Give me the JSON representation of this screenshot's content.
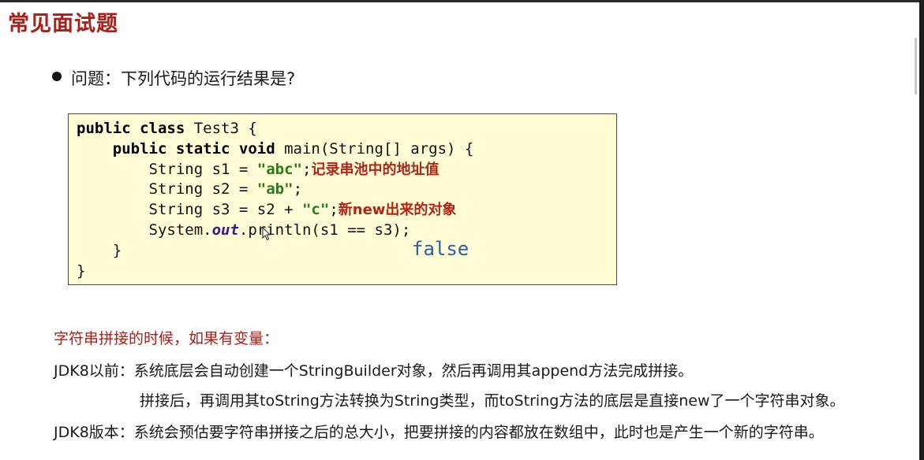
{
  "title": "常见面试题",
  "question": "问题：下列代码的运行结果是?",
  "code": {
    "l1": {
      "a": "public class",
      "b": " Test3 {"
    },
    "l2": {
      "indent": "    ",
      "a": "public static void",
      "b": " main(String[] args) {"
    },
    "l3": {
      "indent": "        ",
      "a": "String s1 = ",
      "s": "\"abc\"",
      "b": ";",
      "note": "记录串池中的地址值"
    },
    "l4": {
      "indent": "        ",
      "a": "String s2 = ",
      "s": "\"ab\"",
      "b": ";"
    },
    "l5": {
      "indent": "        ",
      "a": "String s3 = s2 + ",
      "s": "\"c\"",
      "b": ";",
      "note": "新new出来的对象"
    },
    "l6": {
      "indent": "        ",
      "a": "System.",
      "f": "out",
      "b": ".println(s1 == s3);"
    },
    "l7": {
      "indent": "    ",
      "a": "}"
    },
    "l8": {
      "a": "}"
    }
  },
  "result": "false",
  "red_label": "字符串拼接的时候，如果有变量：",
  "notes": {
    "jdk8_before_1": "JDK8以前：系统底层会自动创建一个StringBuilder对象，然后再调用其append方法完成拼接。",
    "jdk8_before_2": "拼接后，再调用其toString方法转换为String类型，而toString方法的底层是直接new了一个字符串对象。",
    "jdk8_version": "JDK8版本：系统会预估要字符串拼接之后的总大小，把要拼接的内容都放在数组中，此时也是产生一个新的字符串。"
  }
}
